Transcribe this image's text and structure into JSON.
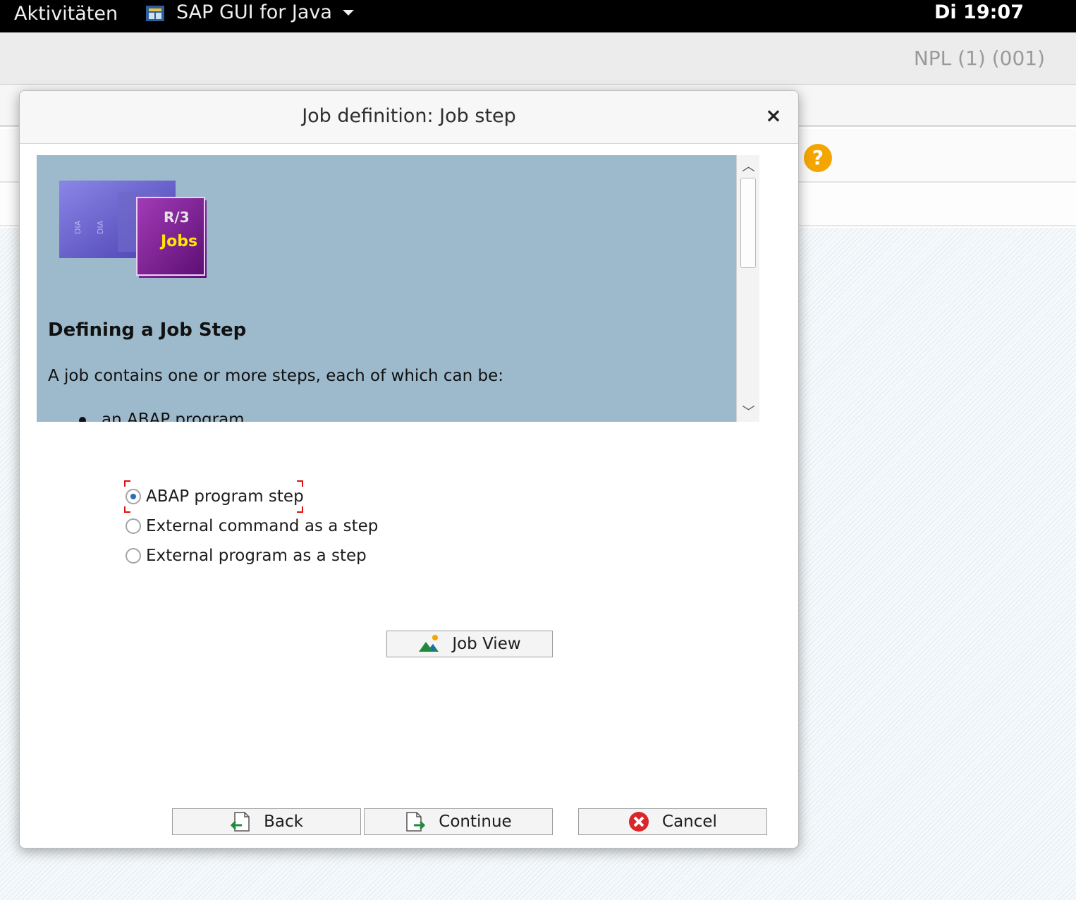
{
  "topbar": {
    "activities": "Aktivitäten",
    "app_name": "SAP GUI for Java",
    "clock": "Di 19:07"
  },
  "sap_window": {
    "system_info": "NPL (1) (001)"
  },
  "dialog": {
    "title": "Job definition: Job step",
    "help": {
      "logo_text_top": "R/3",
      "logo_text_bottom": "Jobs",
      "heading": "Defining a Job Step",
      "intro": "A job contains one or more steps, each of which can be:",
      "bullet_1": "an ABAP program"
    },
    "step_options": [
      {
        "label": "ABAP program step",
        "selected": true
      },
      {
        "label": "External command as a step",
        "selected": false
      },
      {
        "label": "External program as a step",
        "selected": false
      }
    ],
    "job_view_label": "Job View",
    "back_label": "Back",
    "continue_label": "Continue",
    "cancel_label": "Cancel"
  },
  "colors": {
    "help_panel_bg": "#9dbacc",
    "help_icon": "#f5a500",
    "cancel_icon": "#d9262b",
    "radio_selected": "#2a6fb5"
  }
}
